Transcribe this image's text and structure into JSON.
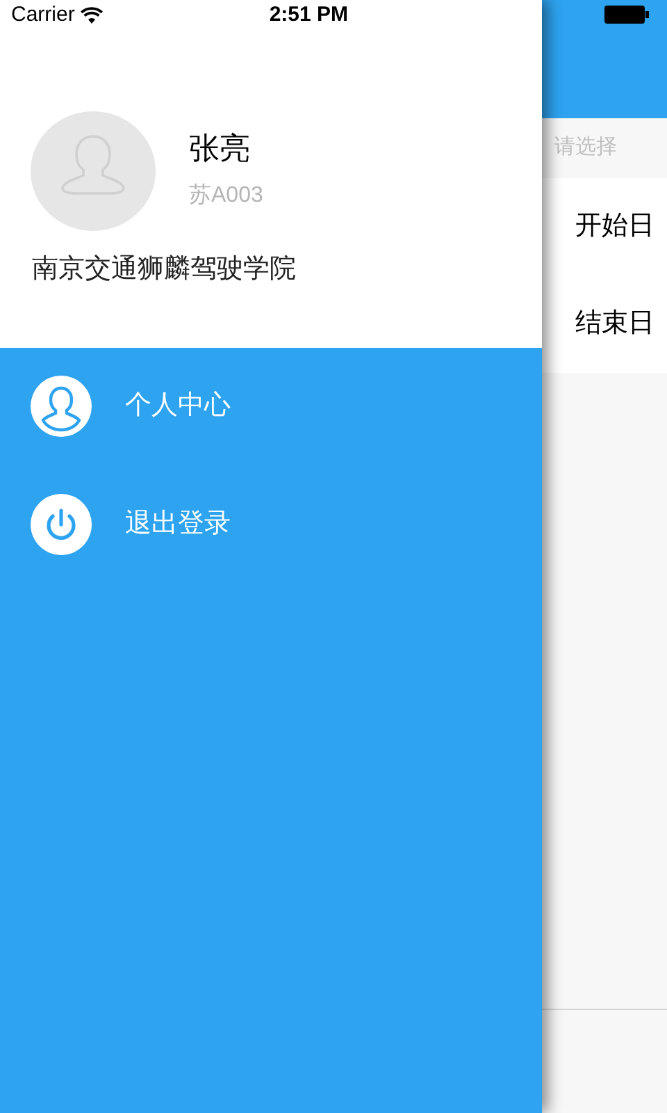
{
  "status_bar": {
    "carrier": "Carrier",
    "time": "2:51 PM"
  },
  "profile": {
    "name": "张亮",
    "plate": "苏A003",
    "school": "南京交通狮麟驾驶学院"
  },
  "menu": [
    {
      "kind": "person",
      "label": "个人中心"
    },
    {
      "kind": "power",
      "label": "退出登录"
    }
  ],
  "main": {
    "hint": "请选择",
    "rows": [
      "开始日",
      "结束日"
    ]
  }
}
